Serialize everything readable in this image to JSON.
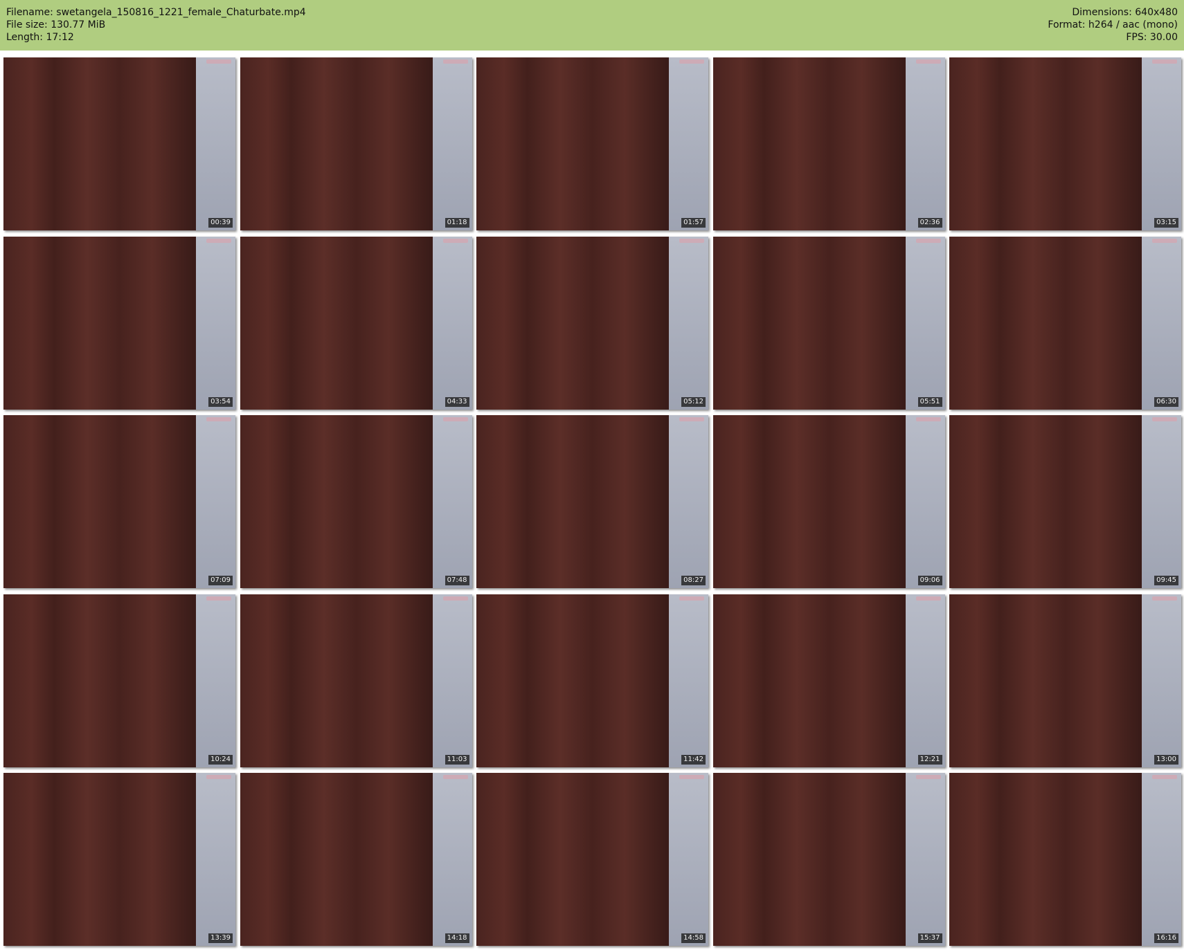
{
  "header": {
    "filename_label": "Filename: swetangela_150816_1221_female_Chaturbate.mp4",
    "filesize_label": "File size: 130.77 MiB",
    "length_label": "Length: 17:12",
    "dimensions_label": "Dimensions: 640x480",
    "format_label": "Format: h264 / aac (mono)",
    "fps_label": "FPS: 30.00"
  },
  "thumbnails": [
    "00:39",
    "01:18",
    "01:57",
    "02:36",
    "03:15",
    "03:54",
    "04:33",
    "05:12",
    "05:51",
    "06:30",
    "07:09",
    "07:48",
    "08:27",
    "09:06",
    "09:45",
    "10:24",
    "11:03",
    "11:42",
    "12:21",
    "13:00",
    "13:39",
    "14:18",
    "14:58",
    "15:37",
    "16:16"
  ]
}
